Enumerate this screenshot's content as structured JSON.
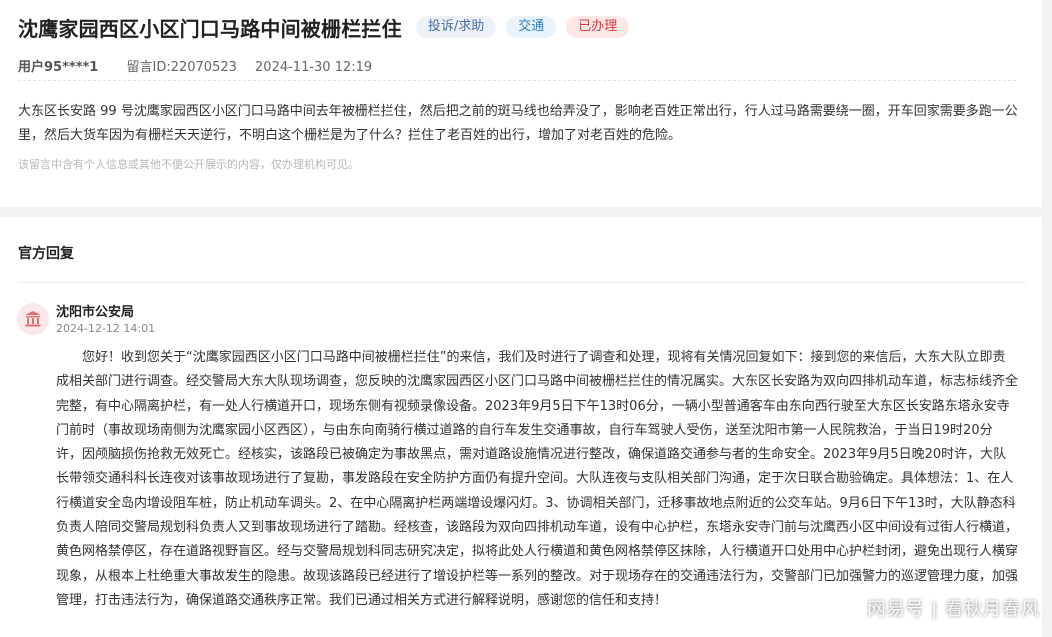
{
  "post": {
    "title": "沈鹰家园西区小区门口马路中间被栅栏拦住",
    "tags": {
      "type": "投诉/求助",
      "category": "交通",
      "status": "已办理"
    },
    "user": "用户95****1",
    "message_id": "留言ID:22070523",
    "time": "2024-11-30 12:19",
    "content": "大东区长安路 99 号沈鹰家园西区小区门口马路中间去年被栅栏拦住，然后把之前的斑马线也给弄没了，影响老百姓正常出行，行人过马路需要绕一圈，开车回家需要多跑一公里，然后大货车因为有栅栏天天逆行，不明白这个栅栏是为了什么？拦住了老百姓的出行，增加了对老百姓的危险。",
    "privacy_notice": "该留言中含有个人信息或其他不便公开展示的内容，仅办理机构可见。"
  },
  "reply": {
    "section_title": "官方回复",
    "org_name": "沈阳市公安局",
    "time": "2024-12-12 14:01",
    "body": "您好！收到您关于“沈鹰家园西区小区门口马路中间被栅栏拦住”的来信，我们及时进行了调查和处理，现将有关情况回复如下：接到您的来信后，大东大队立即责成相关部门进行调查。经交警局大东大队现场调查，您反映的沈鹰家园西区小区门口马路中间被栅栏拦住的情况属实。大东区长安路为双向四排机动车道，标志标线齐全完整，有中心隔离护栏，有一处人行横道开口，现场东侧有视频录像设备。2023年9月5日下午13时06分，一辆小型普通客车由东向西行驶至大东区长安路东塔永安寺门前时（事故现场南侧为沈鹰家园小区西区），与由东向南骑行横过道路的自行车发生交通事故，自行车驾驶人受伤，送至沈阳市第一人民院救治，于当日19时20分许，因颅脑损伤抢救无效死亡。经核实，该路段已被确定为事故黑点，需对道路设施情况进行整改，确保道路交通参与者的生命安全。2023年9月5日晚20时许，大队长带领交通科科长连夜对该事故现场进行了复勘，事发路段在安全防护方面仍有提升空间。大队连夜与支队相关部门沟通，定于次日联合勘验确定。具体想法：1、在人行横道安全岛内增设阻车桩，防止机动车调头。2、在中心隔离护栏两端增设爆闪灯。3、协调相关部门，迁移事故地点附近的公交车站。9月6日下午13时，大队静态科负责人陪同交警局规划科负责人又到事故现场进行了踏勘。经核查，该路段为双向四排机动车道，设有中心护栏，东塔永安寺门前与沈鹰西小区中间设有过街人行横道，黄色网格禁停区，存在道路视野盲区。经与交警局规划科同志研究决定，拟将此处人行横道和黄色网格禁停区抹除，人行横道开口处用中心护栏封闭，避免出现行人横穿现象，从根本上杜绝重大事故发生的隐患。故现该路段已经进行了增设护栏等一系列的整改。对于现场存在的交通违法行为，交警部门已加强警力的巡逻管理力度，加强管理，打击违法行为，确保道路交通秩序正常。我们已通过相关方式进行解释说明，感谢您的信任和支持！"
  },
  "watermark": "网易号 | 看秋月春风",
  "colors": {
    "status_red": "#d23c3c",
    "category_blue": "#2f7fc1",
    "avatar_bg": "#fbe9e9",
    "avatar_icon": "#e07070"
  },
  "icons": {
    "org_avatar": "government-building-icon"
  }
}
